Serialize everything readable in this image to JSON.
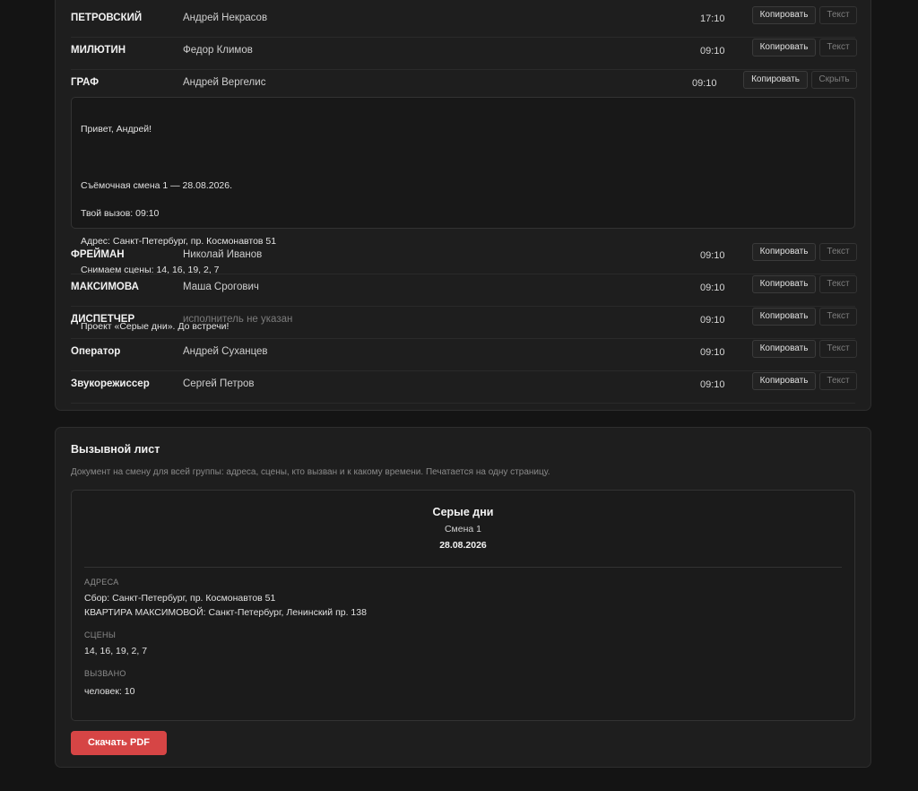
{
  "cast_rows": [
    {
      "role": "ПЕТРОВСКИЙ",
      "actor": "Андрей Некрасов",
      "time": "17:10",
      "copy": "Копировать",
      "text": "Текст"
    },
    {
      "role": "МИЛЮТИН",
      "actor": "Федор Климов",
      "time": "09:10",
      "copy": "Копировать",
      "text": "Текст"
    },
    {
      "role": "ГРАФ",
      "actor": "Андрей Вергелис",
      "time": "09:10",
      "copy": "Копировать",
      "text": "Скрыть"
    },
    {
      "role": "ФРЕЙМАН",
      "actor": "Николай Иванов",
      "time": "09:10",
      "copy": "Копировать",
      "text": "Текст"
    },
    {
      "role": "МАКСИМОВА",
      "actor": "Маша Срогович",
      "time": "09:10",
      "copy": "Копировать",
      "text": "Текст"
    },
    {
      "role": "ДИСПЕТЧЕР",
      "actor": "исполнитель не указан",
      "time": "09:10",
      "copy": "Копировать",
      "text": "Текст"
    },
    {
      "role": "Оператор",
      "actor": "Андрей Суханцев",
      "time": "09:10",
      "copy": "Копировать",
      "text": "Текст"
    },
    {
      "role": "Звукорежиссер",
      "actor": "Сергей Петров",
      "time": "09:10",
      "copy": "Копировать",
      "text": "Текст"
    }
  ],
  "message": {
    "greeting": "Привет, Андрей!",
    "shift_line": "Съёмочная смена 1 — 28.08.2026.",
    "call_line": "Твой вызов: 09:10",
    "address_line": "Адрес: Санкт-Петербург, пр. Космонавтов 51",
    "scenes_line": "Снимаем сцены: 14, 16, 19, 2, 7",
    "closing": "Проект «Серые дни». До встречи!"
  },
  "callsheet": {
    "title": "Вызывной лист",
    "description": "Документ на смену для всей группы: адреса, сцены, кто вызван и к какому времени. Печатается на одну страницу.",
    "project": "Серые дни",
    "shift": "Смена 1",
    "date": "28.08.2026",
    "addresses_label": "АДРЕСА",
    "addresses": [
      "Сбор: Санкт-Петербург, пр. Космонавтов 51",
      "КВАРТИРА МАКСИМОВОЙ: Санкт-Петербург, Ленинский пр. 138"
    ],
    "scenes_label": "СЦЕНЫ",
    "scenes": "14, 16, 19, 2, 7",
    "called_label": "ВЫЗВАНО",
    "called": "человек: 10",
    "download_label": "Скачать PDF"
  },
  "colors": {
    "background": "#141414",
    "card": "#1e1e1e",
    "accent": "#d64545"
  }
}
